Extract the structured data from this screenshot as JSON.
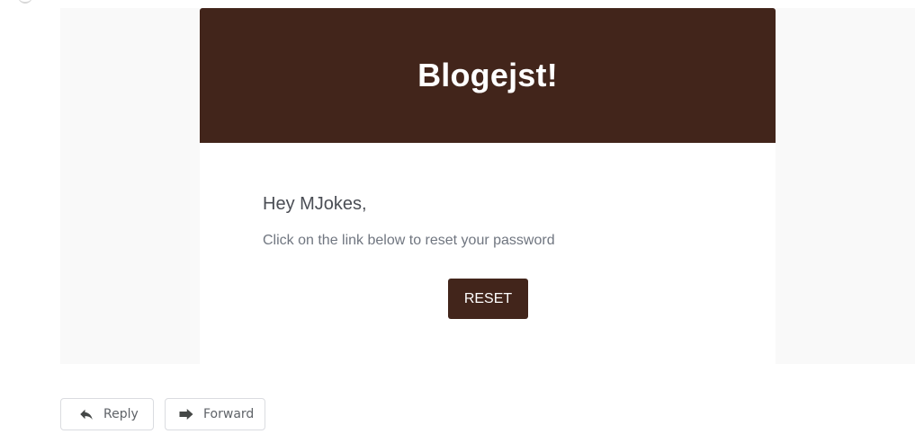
{
  "email": {
    "brand": "Blogejst!",
    "greeting": "Hey MJokes,",
    "message": "Click on the link below to reset your password",
    "button_label": "RESET",
    "header_color": "#42251b"
  },
  "actions": {
    "reply_label": "Reply",
    "forward_label": "Forward",
    "reply_icon": "reply-icon",
    "forward_icon": "forward-icon"
  }
}
